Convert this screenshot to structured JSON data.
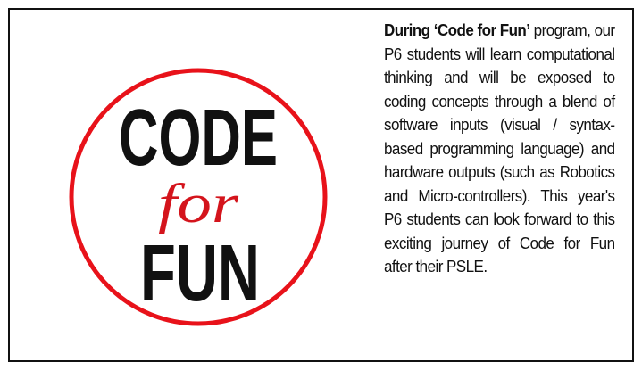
{
  "logo": {
    "line1": "CODE",
    "line2": "for",
    "line3": "FUN",
    "colors": {
      "ring": "#e8121a",
      "script": "#d4141c",
      "block": "#111111"
    }
  },
  "description": {
    "bold_lead": "During ‘Code for Fun’",
    "body": " program, our P6 students will learn computational thinking and will be exposed to coding concepts through a blend of software inputs (visual / syntax-based programming language) and hardware outputs (such as Robotics and Micro-controllers). This year's P6 students can look forward to this exciting journey of Code for Fun after their PSLE."
  }
}
